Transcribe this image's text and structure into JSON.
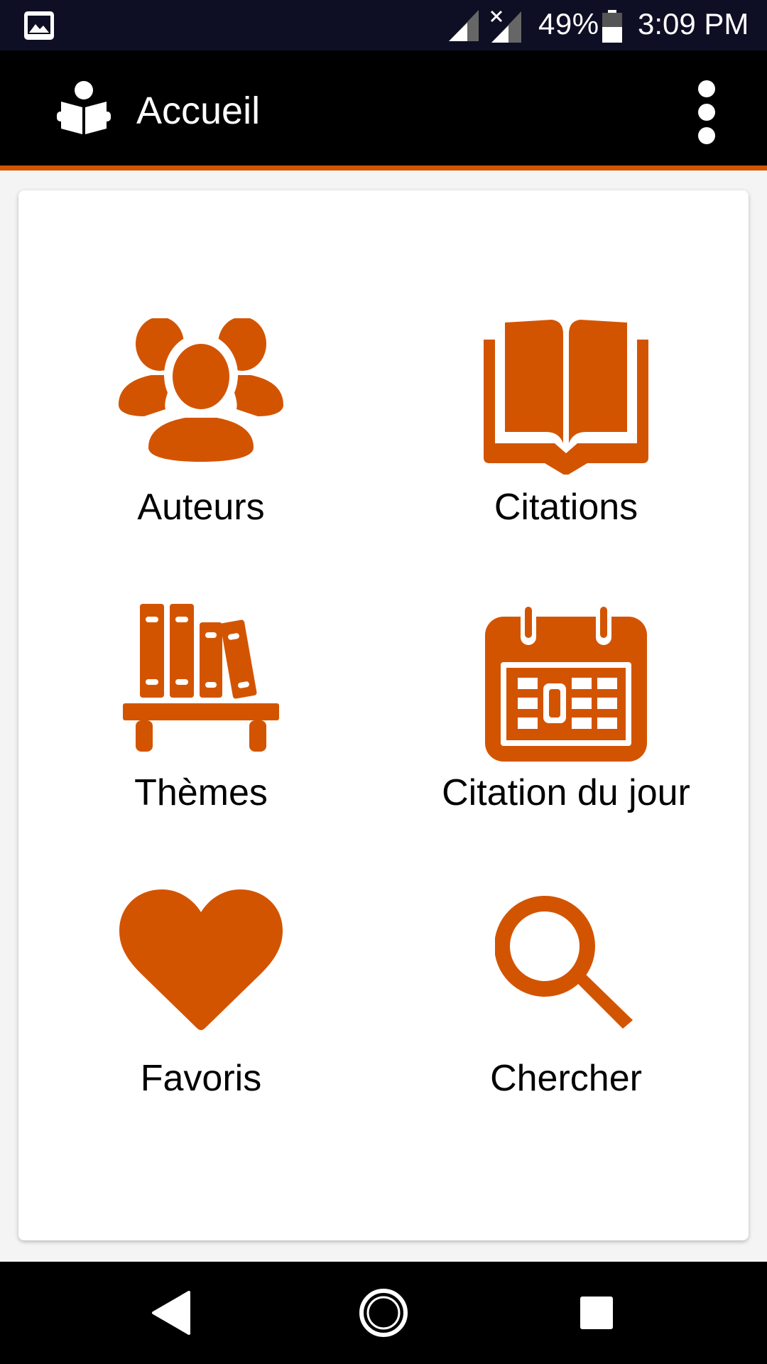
{
  "status_bar": {
    "battery_percent": "49%",
    "time": "3:09 PM",
    "icons": [
      "gallery-icon",
      "signal-icon",
      "signal-no-service-icon",
      "battery-icon"
    ]
  },
  "app_bar": {
    "title": "Accueil",
    "logo_icon": "reading-person-icon",
    "menu_icon": "more-vert-icon"
  },
  "colors": {
    "accent": "#d35400",
    "status_bar": "#0e0f24",
    "app_bar": "#000000"
  },
  "menu": {
    "items": [
      {
        "label": "Auteurs",
        "icon": "users-icon"
      },
      {
        "label": "Citations",
        "icon": "open-book-icon"
      },
      {
        "label": "Thèmes",
        "icon": "bookshelf-icon"
      },
      {
        "label": "Citation du jour",
        "icon": "calendar-icon"
      },
      {
        "label": "Favoris",
        "icon": "heart-icon"
      },
      {
        "label": "Chercher",
        "icon": "search-icon"
      }
    ]
  },
  "nav_bar": {
    "buttons": [
      "back-icon",
      "home-icon",
      "recents-icon"
    ]
  }
}
